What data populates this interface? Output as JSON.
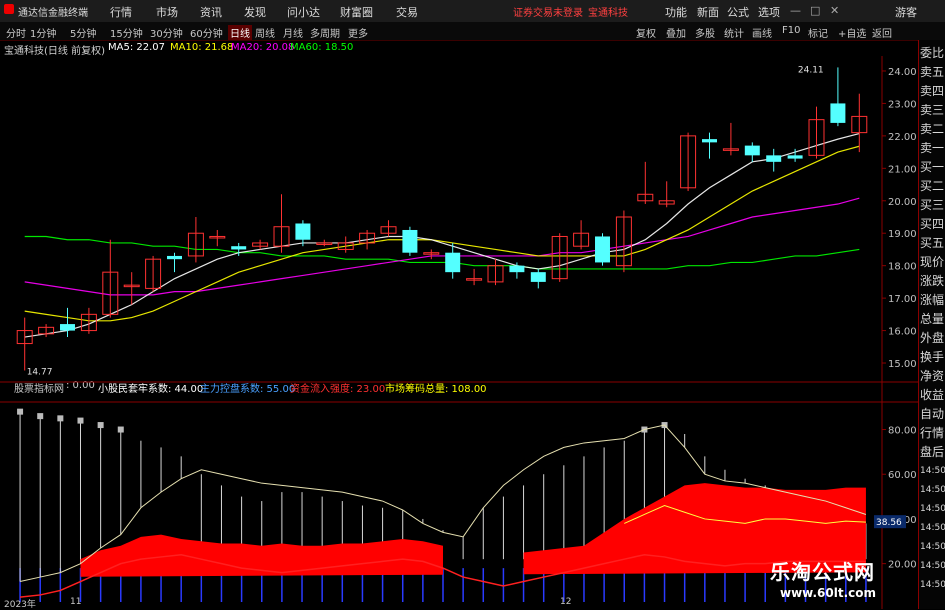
{
  "app_title": "通达信金融终端",
  "menu": [
    "行情",
    "市场",
    "资讯",
    "发现",
    "问小达",
    "财富圈",
    "交易"
  ],
  "notice": "证券交易未登录",
  "stock_header": "宝通科技",
  "right_menu": [
    "功能",
    "新面",
    "公式",
    "选项",
    "游客"
  ],
  "periods": [
    "分时",
    "1分钟",
    "5分钟",
    "15分钟",
    "30分钟",
    "60分钟",
    "日线",
    "周线",
    "月线",
    "多周期",
    "更多"
  ],
  "active_period": "日线",
  "toolbar": [
    "复权",
    "叠加",
    "多股",
    "统计",
    "画线",
    "F10",
    "标记",
    "+自选",
    "返回"
  ],
  "info": {
    "stock": "宝通科技(日线 前复权)",
    "ma5": "MA5: 22.07",
    "ma10": "MA10: 21.68",
    "ma20": "MA20: 20.08",
    "ma60": "MA60: 18.50"
  },
  "indicator": {
    "name": "股票指标网",
    "v0": ": 0.00",
    "v1": "小股民套牢系数: 44.00",
    "v2": "主力控盘系数: 55.00",
    "v3": "资金流入强度: 23.00",
    "v4": "市场筹码总量: 108.00",
    "last_value": "38.56"
  },
  "price_axis": [
    "24.00",
    "23.00",
    "22.00",
    "21.00",
    "20.00",
    "19.00",
    "18.00",
    "17.00",
    "16.00",
    "15.00"
  ],
  "ind_axis": [
    "80.00",
    "60.00",
    "40.00",
    "20.00"
  ],
  "annotations": {
    "high": "24.11",
    "low": "14.77"
  },
  "dates": [
    "2023年",
    "11",
    "12"
  ],
  "right_panel": [
    "委比",
    "卖五",
    "卖四",
    "卖三",
    "卖二",
    "卖一",
    "买一",
    "买二",
    "买三",
    "买四",
    "买五",
    "现价",
    "涨跌",
    "涨幅",
    "总量",
    "外盘",
    "换手",
    "净资",
    "收益",
    "自动",
    "行情",
    "盘后",
    "14:50",
    "14:50",
    "14:50",
    "14:50",
    "14:50",
    "14:50",
    "14:50"
  ],
  "watermark": {
    "line1": "乐淘公式网",
    "line2": "www.60lt.com"
  },
  "colors": {
    "up": "#ff3232",
    "down": "#54ffff",
    "ma5": "#ffffff",
    "ma10": "#ffff00",
    "ma20": "#ff00ff",
    "ma60": "#00ff00",
    "bg": "#000000"
  },
  "chart_data": {
    "type": "candlestick",
    "y_range": [
      14.6,
      24.4
    ],
    "candles": [
      {
        "o": 15.6,
        "c": 16.0,
        "h": 16.4,
        "l": 14.77
      },
      {
        "o": 15.9,
        "c": 16.1,
        "h": 16.2,
        "l": 15.8
      },
      {
        "o": 16.2,
        "c": 16.0,
        "h": 16.7,
        "l": 15.8
      },
      {
        "o": 16.0,
        "c": 16.5,
        "h": 16.7,
        "l": 15.9
      },
      {
        "o": 16.5,
        "c": 17.8,
        "h": 18.8,
        "l": 16.4
      },
      {
        "o": 17.4,
        "c": 17.4,
        "h": 17.8,
        "l": 16.8
      },
      {
        "o": 17.3,
        "c": 18.2,
        "h": 18.3,
        "l": 17.2
      },
      {
        "o": 18.3,
        "c": 18.2,
        "h": 18.4,
        "l": 17.8
      },
      {
        "o": 18.3,
        "c": 19.0,
        "h": 19.5,
        "l": 18.1
      },
      {
        "o": 18.9,
        "c": 18.9,
        "h": 19.1,
        "l": 18.6
      },
      {
        "o": 18.6,
        "c": 18.5,
        "h": 18.7,
        "l": 18.3
      },
      {
        "o": 18.6,
        "c": 18.7,
        "h": 18.8,
        "l": 18.5
      },
      {
        "o": 18.6,
        "c": 19.2,
        "h": 20.2,
        "l": 18.4
      },
      {
        "o": 19.3,
        "c": 18.8,
        "h": 19.4,
        "l": 18.6
      },
      {
        "o": 18.7,
        "c": 18.7,
        "h": 18.8,
        "l": 18.6
      },
      {
        "o": 18.5,
        "c": 18.7,
        "h": 18.9,
        "l": 18.4
      },
      {
        "o": 18.7,
        "c": 19.0,
        "h": 19.1,
        "l": 18.5
      },
      {
        "o": 19.0,
        "c": 19.2,
        "h": 19.4,
        "l": 18.9
      },
      {
        "o": 19.1,
        "c": 18.4,
        "h": 19.2,
        "l": 18.3
      },
      {
        "o": 18.4,
        "c": 18.4,
        "h": 18.5,
        "l": 18.2
      },
      {
        "o": 18.4,
        "c": 17.8,
        "h": 18.7,
        "l": 17.6
      },
      {
        "o": 17.6,
        "c": 17.6,
        "h": 17.9,
        "l": 17.4
      },
      {
        "o": 17.5,
        "c": 18.0,
        "h": 18.2,
        "l": 17.4
      },
      {
        "o": 18.0,
        "c": 17.8,
        "h": 18.1,
        "l": 17.6
      },
      {
        "o": 17.8,
        "c": 17.5,
        "h": 17.9,
        "l": 17.3
      },
      {
        "o": 17.6,
        "c": 18.9,
        "h": 19.0,
        "l": 17.5
      },
      {
        "o": 18.6,
        "c": 19.0,
        "h": 19.4,
        "l": 18.5
      },
      {
        "o": 18.9,
        "c": 18.1,
        "h": 19.0,
        "l": 18.0
      },
      {
        "o": 18.0,
        "c": 19.5,
        "h": 19.7,
        "l": 17.8
      },
      {
        "o": 20.0,
        "c": 20.2,
        "h": 21.2,
        "l": 19.9
      },
      {
        "o": 19.9,
        "c": 20.0,
        "h": 20.6,
        "l": 19.8
      },
      {
        "o": 20.4,
        "c": 22.0,
        "h": 22.1,
        "l": 20.3
      },
      {
        "o": 21.9,
        "c": 21.8,
        "h": 22.1,
        "l": 21.3
      },
      {
        "o": 21.6,
        "c": 21.6,
        "h": 22.4,
        "l": 21.4
      },
      {
        "o": 21.7,
        "c": 21.4,
        "h": 21.8,
        "l": 21.2
      },
      {
        "o": 21.4,
        "c": 21.2,
        "h": 21.6,
        "l": 20.9
      },
      {
        "o": 21.4,
        "c": 21.3,
        "h": 21.6,
        "l": 21.2
      },
      {
        "o": 21.4,
        "c": 22.5,
        "h": 22.9,
        "l": 21.3
      },
      {
        "o": 23.0,
        "c": 22.4,
        "h": 24.11,
        "l": 22.3
      },
      {
        "o": 22.1,
        "c": 22.6,
        "h": 23.3,
        "l": 21.5
      }
    ],
    "ma5": [
      15.8,
      15.9,
      16.0,
      16.2,
      16.5,
      16.8,
      17.2,
      17.6,
      17.9,
      18.2,
      18.4,
      18.5,
      18.6,
      18.7,
      18.7,
      18.7,
      18.8,
      18.9,
      18.9,
      18.8,
      18.6,
      18.4,
      18.2,
      18.0,
      17.9,
      18.0,
      18.2,
      18.4,
      18.5,
      18.8,
      19.3,
      19.9,
      20.4,
      20.8,
      21.2,
      21.3,
      21.5,
      21.7,
      21.9,
      22.07
    ],
    "ma10": [
      16.6,
      16.5,
      16.4,
      16.3,
      16.3,
      16.4,
      16.6,
      16.9,
      17.2,
      17.5,
      17.8,
      18.0,
      18.2,
      18.4,
      18.5,
      18.6,
      18.7,
      18.8,
      18.8,
      18.8,
      18.7,
      18.6,
      18.5,
      18.4,
      18.3,
      18.3,
      18.3,
      18.3,
      18.3,
      18.5,
      18.8,
      19.1,
      19.5,
      19.9,
      20.3,
      20.6,
      20.9,
      21.2,
      21.5,
      21.68
    ],
    "ma20": [
      17.5,
      17.4,
      17.3,
      17.2,
      17.1,
      17.1,
      17.1,
      17.2,
      17.2,
      17.3,
      17.4,
      17.5,
      17.6,
      17.7,
      17.8,
      17.9,
      18.0,
      18.1,
      18.2,
      18.3,
      18.3,
      18.3,
      18.3,
      18.3,
      18.3,
      18.4,
      18.4,
      18.5,
      18.6,
      18.7,
      18.8,
      18.9,
      19.1,
      19.3,
      19.5,
      19.6,
      19.7,
      19.8,
      19.9,
      20.08
    ],
    "ma60": [
      18.9,
      18.9,
      18.8,
      18.8,
      18.7,
      18.7,
      18.6,
      18.6,
      18.5,
      18.5,
      18.4,
      18.4,
      18.3,
      18.3,
      18.3,
      18.2,
      18.2,
      18.2,
      18.1,
      18.1,
      18.1,
      18.0,
      18.0,
      18.0,
      17.9,
      17.9,
      17.9,
      17.9,
      17.9,
      17.9,
      17.9,
      18.0,
      18.0,
      18.1,
      18.1,
      18.2,
      18.3,
      18.3,
      18.4,
      18.5
    ],
    "indicator": {
      "y_range": [
        10,
        95
      ],
      "white_bars": [
        88,
        86,
        85,
        84,
        82,
        80,
        75,
        72,
        68,
        60,
        55,
        50,
        48,
        52,
        52,
        50,
        48,
        46,
        45,
        44,
        40,
        35,
        32,
        45,
        50,
        55,
        60,
        64,
        68,
        72,
        75,
        80,
        82,
        78,
        68,
        62,
        58,
        55,
        52,
        48,
        44,
        40,
        38
      ],
      "white_line": [
        12,
        14,
        16,
        20,
        27,
        33,
        45,
        52,
        58,
        62,
        60,
        58,
        56,
        55,
        54,
        53,
        52,
        50,
        48,
        44,
        38,
        34,
        32,
        45,
        55,
        62,
        68,
        72,
        74,
        75,
        76,
        80,
        82,
        72,
        60,
        57,
        56,
        54,
        52,
        50,
        48,
        45,
        42
      ],
      "red_area": [
        0,
        0,
        0,
        22,
        26,
        28,
        32,
        33,
        31,
        30,
        29,
        29,
        28,
        29,
        28,
        28,
        29,
        29,
        30,
        31,
        30,
        28,
        0,
        0,
        0,
        25,
        26,
        27,
        28,
        34,
        40,
        45,
        50,
        55,
        56,
        55,
        54,
        54,
        53,
        53,
        53,
        54,
        54
      ],
      "red_line": [
        5,
        6,
        8,
        12,
        16,
        20,
        22,
        23,
        24,
        22,
        20,
        18,
        17,
        16,
        17,
        18,
        19,
        20,
        21,
        22,
        21,
        18,
        14,
        12,
        10,
        12,
        14,
        16,
        18,
        20,
        22,
        24,
        23,
        21,
        20,
        19,
        20,
        20,
        21,
        21,
        21,
        21,
        21
      ],
      "yellow_line": [
        0,
        0,
        0,
        0,
        0,
        0,
        0,
        0,
        0,
        0,
        0,
        0,
        0,
        0,
        0,
        0,
        0,
        0,
        0,
        0,
        0,
        0,
        0,
        0,
        0,
        0,
        0,
        0,
        0,
        0,
        38,
        42,
        46,
        43,
        40,
        39,
        38,
        40,
        40,
        39,
        38,
        39,
        38.56
      ]
    }
  }
}
